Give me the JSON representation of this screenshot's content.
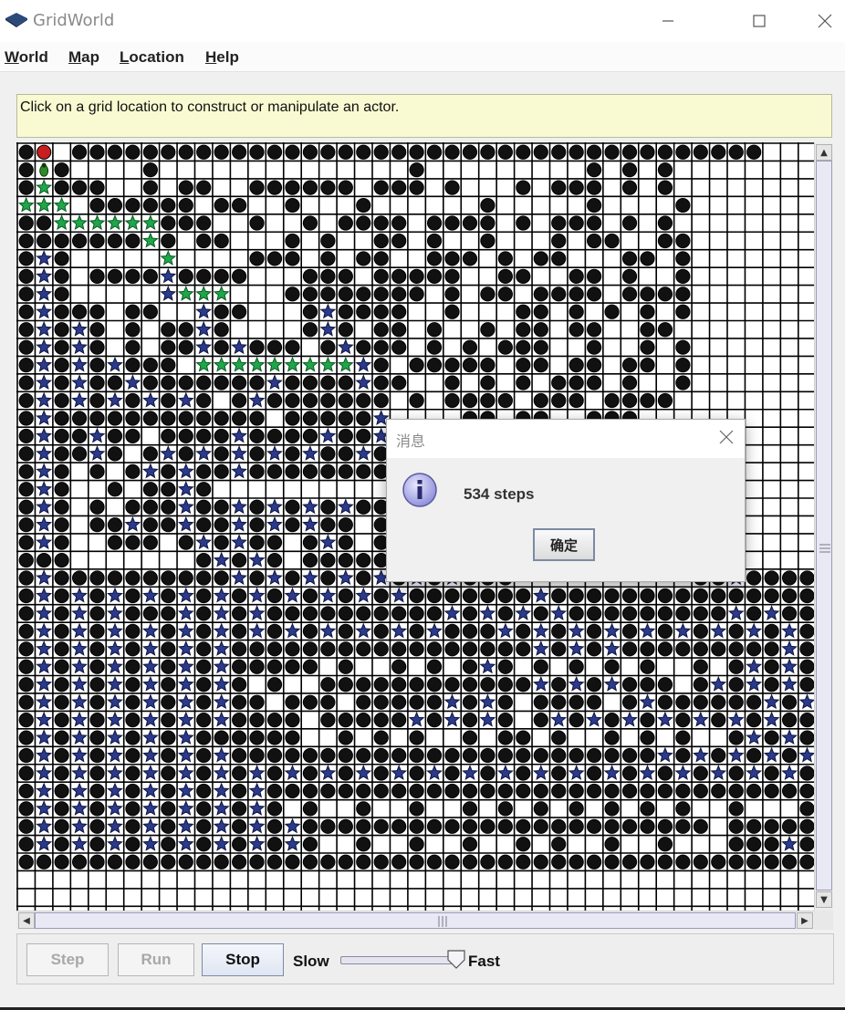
{
  "window": {
    "title": "GridWorld"
  },
  "menu": [
    {
      "label_u": "W",
      "label_rest": "orld"
    },
    {
      "label_u": "M",
      "label_rest": "ap"
    },
    {
      "label_u": "L",
      "label_rest": "ocation"
    },
    {
      "label_u": "H",
      "label_rest": "elp"
    }
  ],
  "message_bar": {
    "text": "Click on a grid location to construct or manipulate an actor."
  },
  "grid": {
    "rows": 42,
    "cols": 45,
    "legend": {
      "O": "rock",
      "*": "visited-flower",
      "G": "green-flower",
      ".": "empty",
      "R": "red-rock",
      "B": "bug"
    },
    "cell_rows": [
      "ORHOOOOOOOOOOOOOOOOOOOOOOOOOOOOOOOOOOOOOOO...",
      "OBO....O..............O.........O.O.O......",
      "OGOOO..O.OO..OOOOOO.OOO.O...O.OOO.O.O......",
      "GGG.OOOOOO.OO..O...O......O.....O....O.....",
      "OOGGGGGGOOO..O..O.OOOO.OOOO.O.OOO.O.O......",
      "OOOOOOOGO.OO...O.O..OO.O..O...O.OO..OO.....",
      "O*O.....G....OOO.O.OO..OOO.O.OO...OO.O.....",
      "O*O.OOOO*OOOO...OOO.OOOOO..OO..OO.O..O.....",
      "O*O.....*GGG...OOOOOOOO.O.OO.OOOO.OOOO.....",
      "O*OOO.OO..*OO...O*OOOO..O...OO.O.O.O.O.....",
      "O*O*O.O.OO*O....O*O.OO.O..O.OO.OO..OO......",
      "O*O*O.O.OO*O*OOO.O*OOO.O.O.OOO..O..O.O.....",
      "O*O*O*OOO.GGGGGGGGG*O.OOOOO.OO.OO.OO.O.....",
      "O*O*OO*OOOOOOO*OOOO*OO..O.O.O.OOO.O..O.....",
      "O*O*O*O*O*O.O*OOOOOOO.O.OOOO.OOO.OOOO......",
      "O*OOOOOOOOOOOO.OOOOO*....OO.OO..OOO........",
      "O*OO*OO.OOOO*OOOO*OO*....................",
      "O*OO*O.O*O*O*O*O*OO*O*..................",
      "O*O.O.O*O*OO*OOOOOOOOOOOO................",
      "O*O..O.OO*O.................................",
      "O*O.O.OOO*OO*O*O*O*OO..OO................",
      "O*O.OO*OO*OO*O*O*OO.O*OOO...............",
      "O*O..OOO.O*O*OO.O*O.O*O*O................",
      "OOO.......O*O*O.OOOOO.OO.................",
      "O*OOOOOOOOOO*O*O*O*O*O*O*OOO..........OO*OOOOOOOO*O*O*O*O*O",
      "O*O*O*O*O*O*O*O*O*O*O*OOOOOOO*OOOOOOOOOOOOOOOO*O*O*O*O*O*O*O",
      "O*O*O*OOO*O*O*OOOOOOOOOO*O*O*O*OOOOOOOOO*O*OOOOOOOOOO*O*O*O*",
      "O*O*O*O*O*O*O*O*O*O*O*O*OOO*O*O*O*O*O*O*O*O*OOO*O*O*O*O*OOO*",
      "O*O*O*O*O*O*OOOOOOOOOOOOOOOOO*O*O*OOOOOOOOO*O*O*O*O*O*O*O*O*",
      "O*O*O*O*O*O*OOOOO.O..O.O.O*O.O.O.O.O..O.O*O*O*O*O*O*O*O*O*O*",
      "O*O*O*O*O*O*O.O..OOOOOOOOOOOO*O*O*OOO.O*O*O*O*OOOOOO*O*O*O*O",
      "O*O*O*O*O*O*OO.OOO.OOOOO*O*O.OOOO.O*OOOOOO*O*O*O*O*O*O*O*O*O",
      "O*O*O*O*O*O*OOOO.OOOOO*O*O*O.O*O*O*O*O*O*O*OOO*O*O*O*O*O*O*O",
      "O*O*O*O*O*OOOOOO..O.O.O..O.OO.O..O.O.O..O*O*O*O*O*O*O*OO*O*O",
      "O*O*O*O*O*O*OOOOOOOOOOOOOOOOOOOOOOOO*O*O*O*O*O*O*O*O*O*O*O*O",
      "O*O*O*O*O*O*O*O*O*O*O*O*O*O*O*O*O*O*O*O*O*O*O*O*O*O*O*O*O*O*",
      "O*O*O*O*O*O*O*OOOOOOOOOOOOOOOOOOOOOOOOOOOOOOOOOOOOO*O*O*O*O*",
      "O*O*O*O*O*O*O*O.O..O..O..O.O.O.O.O.O.O..O...OO*O*O*O*O*O*O*O",
      "O*O*O*O*O*O*O*O*OOOOOOOOOOOOOOOOOOOOOOO.OOOOOO*O*O*O*O*O*O*O",
      "O*O*O*O*O*O*O*O*O..O..O..O..O.O..O..O...OOO*O*O*O*O*O*O*O*O*",
      "OOOOOOOOOOOOOOOOOOOOOOOOOOOOOOOOOOOOOOOOOOOOOOOOOOOOOOOOOOOO",
      "............................................................"
    ]
  },
  "controls": {
    "step_label": "Step",
    "run_label": "Run",
    "stop_label": "Stop",
    "slow_label": "Slow",
    "fast_label": "Fast",
    "speed_level": 0.92
  },
  "dialog": {
    "title": "消息",
    "message": "534 steps",
    "ok_label": "确定"
  }
}
